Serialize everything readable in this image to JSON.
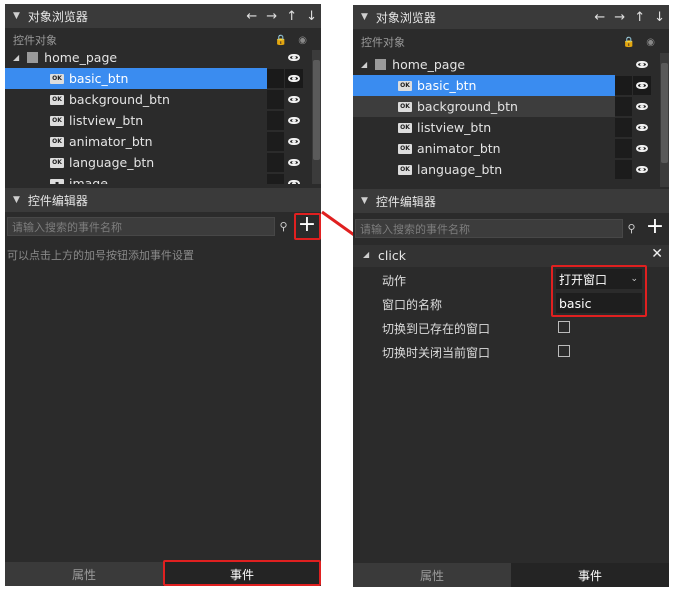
{
  "left": {
    "object_browser": {
      "title": "对象浏览器",
      "nav_icons": [
        "←",
        "→",
        "↑",
        "↓"
      ]
    },
    "controls_label": "控件对象",
    "tree": {
      "root": "home_page",
      "items": [
        "basic_btn",
        "background_btn",
        "listview_btn",
        "animator_btn",
        "language_btn",
        "image"
      ]
    },
    "control_editor": {
      "title": "控件编辑器",
      "search_placeholder": "请输入搜索的事件名称",
      "plus_label": "+"
    },
    "hint": "可以点击上方的加号按钮添加事件设置",
    "tabs": {
      "properties": "属性",
      "events": "事件"
    }
  },
  "right": {
    "object_browser": {
      "title": "对象浏览器",
      "nav_icons": [
        "←",
        "→",
        "↑",
        "↓"
      ]
    },
    "controls_label": "控件对象",
    "tree": {
      "root": "home_page",
      "items": [
        "basic_btn",
        "background_btn",
        "listview_btn",
        "animator_btn",
        "language_btn"
      ]
    },
    "control_editor": {
      "title": "控件编辑器",
      "search_placeholder": "请输入搜索的事件名称",
      "plus_label": "+"
    },
    "event": {
      "name": "click",
      "close": "✕",
      "action_label": "动作",
      "action_value": "打开窗口",
      "window_name_label": "窗口的名称",
      "window_name_value": "basic",
      "switch_existing_label": "切换到已存在的窗口",
      "close_current_label": "切换时关闭当前窗口"
    },
    "tabs": {
      "properties": "属性",
      "events": "事件"
    }
  },
  "colors": {
    "highlight": "#e02020",
    "selection": "#3a8cf0",
    "panel": "#2b2b2b"
  }
}
